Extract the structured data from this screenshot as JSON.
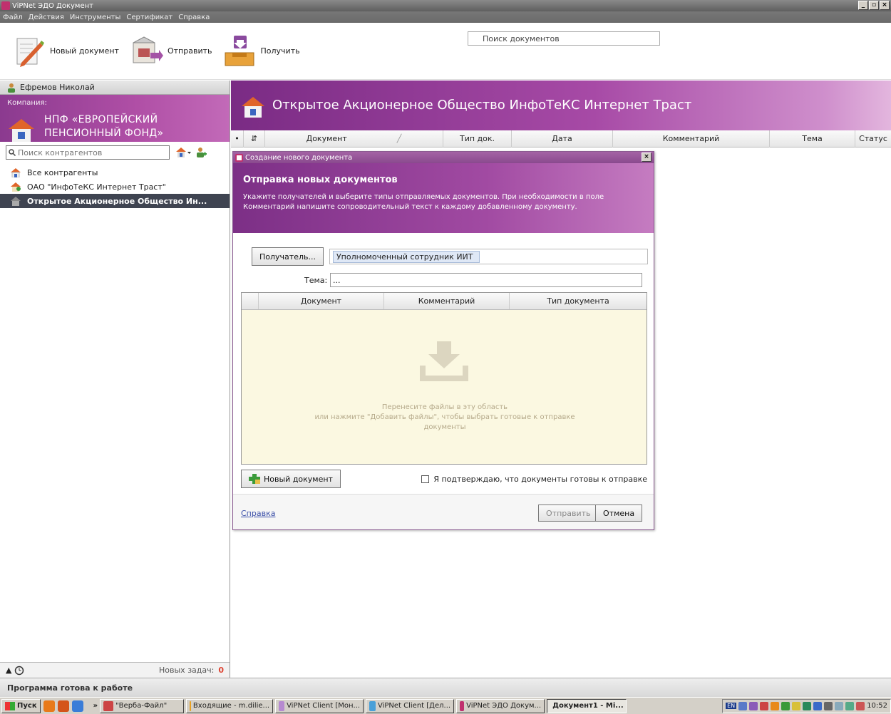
{
  "window": {
    "title": "ViPNet ЭДО Документ"
  },
  "menu": [
    "Файл",
    "Действия",
    "Инструменты",
    "Сертификат",
    "Справка"
  ],
  "toolbar": {
    "new_doc": "Новый документ",
    "send": "Отправить",
    "receive": "Получить"
  },
  "left": {
    "user": "Ефремов Николай",
    "company_label": "Компания:",
    "company_line1": "НПФ «ЕВРОПЕЙСКИЙ",
    "company_line2": "ПЕНСИОННЫЙ ФОНД»",
    "search_placeholder": "Поиск контрагентов",
    "items": [
      {
        "label": "Все контрагенты"
      },
      {
        "label": "ОАО \"ИнфоТеКС Интернет Траст\""
      },
      {
        "label": "Открытое Акционерное Общество Ин..."
      }
    ],
    "tasks_label": "Новых задач:",
    "tasks_count": "0"
  },
  "right": {
    "title": "Открытое Акционерное Общество ИнфоТеКС Интернет Траст",
    "search_placeholder": "Поиск документов",
    "columns": [
      "Документ",
      "Тип док.",
      "Дата",
      "Комментарий",
      "Тема",
      "Статус"
    ]
  },
  "dialog": {
    "title": "Создание нового документа",
    "heading": "Отправка новых документов",
    "desc1": "Укажите получателей и выберите типы отправляемых документов. При необходимости в поле",
    "desc2": "Комментарий напишите сопроводительный текст к каждому добавленному документу.",
    "recipient_button": "Получатель...",
    "recipient_value": "Уполномоченный сотрудник ИИТ",
    "subject_label": "Тема:",
    "subject_value": "...",
    "grid_columns": [
      "Документ",
      "Комментарий",
      "Тип документа"
    ],
    "drop_line1": "Перенесите файлы в эту область",
    "drop_line2": "или нажмите \"Добавить файлы\", чтобы выбрать готовые к отправке",
    "drop_line3": "документы",
    "new_doc_button": "Новый документ",
    "confirm_label": "Я подтверждаю, что документы готовы к отправке",
    "help": "Справка",
    "send": "Отправить",
    "cancel": "Отмена"
  },
  "status": "Программа готова к работе",
  "taskbar": {
    "start": "Пуск",
    "tasks": [
      "\"Верба-Файл\"",
      "Входящие - m.dilie...",
      "ViPNet Client [Мон...",
      "ViPNet Client [Дел...",
      "ViPNet ЭДО Докум...",
      "Документ1 - Mi..."
    ],
    "clock": "10:52",
    "lang": "EN"
  }
}
